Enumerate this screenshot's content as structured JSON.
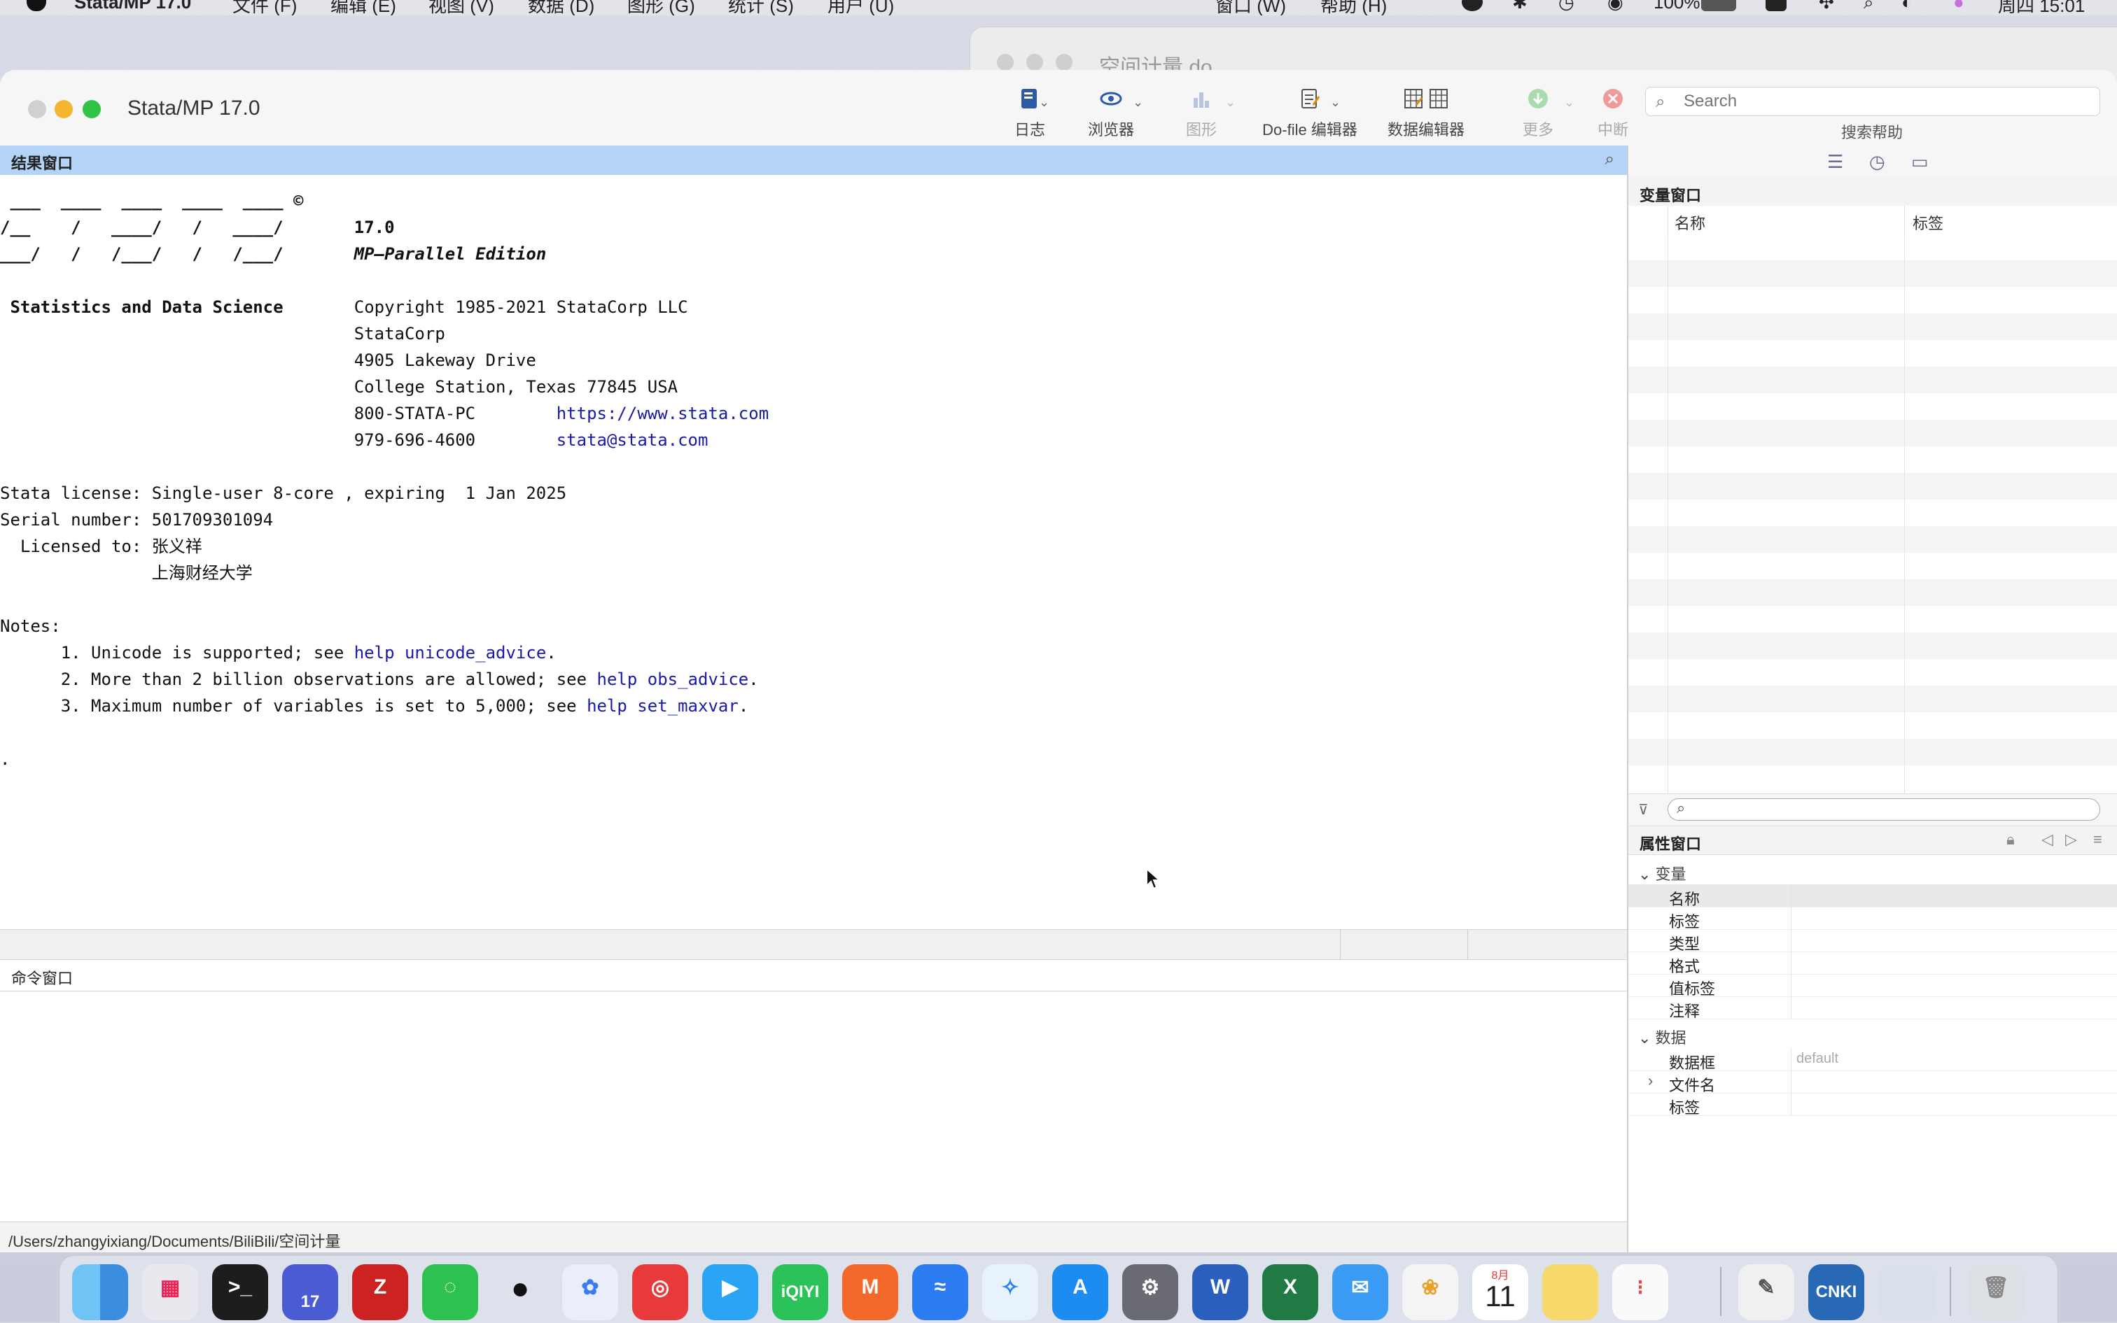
{
  "menubar": {
    "app_name": "Stata/MP 17.0",
    "items": [
      "文件 (F)",
      "编辑 (E)",
      "视图 (V)",
      "数据 (D)",
      "图形 (G)",
      "统计 (S)",
      "用户 (U)"
    ],
    "right_items": [
      "窗口 (W)",
      "帮助 (H)"
    ],
    "battery": "100%",
    "clock": "周四 15:01"
  },
  "background_window": {
    "title": "空间计量.do"
  },
  "window": {
    "title": "Stata/MP 17.0"
  },
  "toolbar": {
    "log": "日志",
    "viewer": "浏览器",
    "graph": "图形",
    "dofile_editor": "Do-file 编辑器",
    "data_editor": "数据编辑器",
    "more": "更多",
    "break": "中断",
    "search_placeholder": "Search",
    "search_help": "搜索帮助"
  },
  "results": {
    "header": "结果窗口",
    "logo_lines": [
      " ___  ____  ____  ____  ____ ©",
      "/__    /   ____/   /   ____/",
      "___/   /   /___/   /   /___/"
    ],
    "version": "17.0",
    "edition": "MP—Parallel Edition",
    "tagline": "Statistics and Data Science",
    "copyright": "Copyright 1985-2021 StataCorp LLC",
    "company": "StataCorp",
    "address1": "4905 Lakeway Drive",
    "address2": "College Station, Texas 77845 USA",
    "phone1": "800-STATA-PC",
    "website": "https://www.stata.com",
    "phone2": "979-696-4600",
    "email": "stata@stata.com",
    "license": "Stata license: Single-user 8-core , expiring  1 Jan 2025",
    "serial": "Serial number: 501709301094",
    "licensed_to": "  Licensed to: 张义祥",
    "licensed_org": "               上海财经大学",
    "notes_title": "Notes:",
    "note1_pre": "      1. Unicode is supported; see ",
    "note1_link": "help unicode_advice",
    "note1_post": ".",
    "note2_pre": "      2. More than 2 billion observations are allowed; see ",
    "note2_link": "help obs_advice",
    "note2_post": ".",
    "note3_pre": "      3. Maximum number of variables is set to 5,000; see ",
    "note3_link": "help set_maxvar",
    "note3_post": ".",
    "prompt": "."
  },
  "command": {
    "header": "命令窗口"
  },
  "path": "/Users/zhangyixiang/Documents/BiliBili/空间计量",
  "variables": {
    "header": "变量窗口",
    "col_name": "名称",
    "col_label": "标签"
  },
  "properties": {
    "header": "属性窗口",
    "group_variable": "变量",
    "var_fields": [
      "名称",
      "标签",
      "类型",
      "格式",
      "值标签",
      "注释"
    ],
    "group_data": "数据",
    "frame_label": "数据框",
    "frame_value": "default",
    "filename_label": "文件名",
    "data_label": "标签"
  },
  "dock": {
    "calendar_month": "8月",
    "calendar_day": "11",
    "launchpad_badge": "17",
    "iqiyi": "iQIYI",
    "cnki": "CNKI"
  }
}
